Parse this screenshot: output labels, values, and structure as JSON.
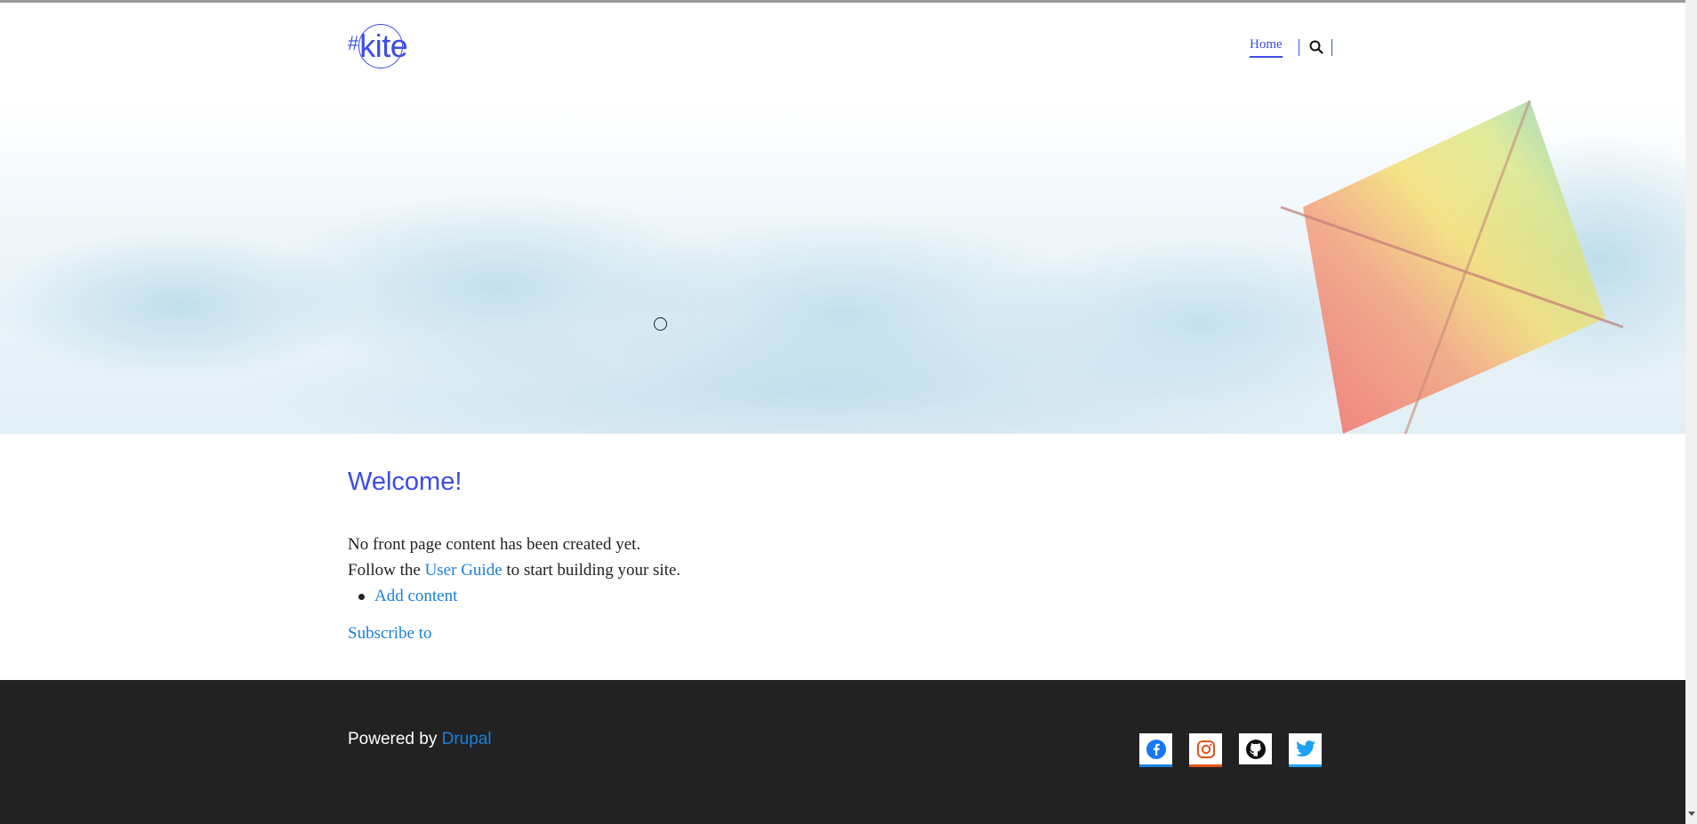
{
  "site": {
    "logo_hash": "#",
    "logo_word": "kite"
  },
  "nav": {
    "home": "Home",
    "search_icon": "search-icon"
  },
  "main": {
    "title": "Welcome!",
    "line1": "No front page content has been created yet.",
    "line2_prefix": "Follow the ",
    "line2_link": "User Guide",
    "line2_suffix": " to start building your site.",
    "add_content": "Add content",
    "subscribe": "Subscribe to"
  },
  "footer": {
    "powered_prefix": "Powered by ",
    "powered_link": "Drupal",
    "socials": [
      "facebook-icon",
      "instagram-icon",
      "github-icon",
      "twitter-icon"
    ]
  },
  "colors": {
    "accent": "#3b4de4",
    "link": "#1a7fe0",
    "footer_bg": "#222222"
  }
}
